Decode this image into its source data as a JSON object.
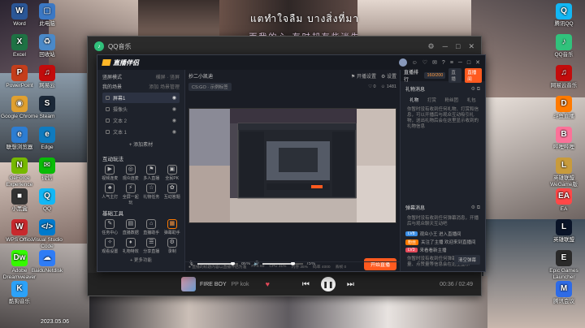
{
  "desktop": {
    "lyrics": {
      "line1": "แตทำใจลืม บางสิ่งที่มา",
      "line2": "而我的心 有时却有些迷失"
    },
    "date_text": "2023.05.06",
    "icons_left": [
      {
        "label": "Word",
        "color": "#2b5797",
        "glyph": "W"
      },
      {
        "label": "此电脑",
        "color": "#3b78c4",
        "glyph": "▢"
      },
      {
        "label": "Excel",
        "color": "#1f7244",
        "glyph": "X"
      },
      {
        "label": "回收站",
        "color": "#4a89c8",
        "glyph": "♻"
      },
      {
        "label": "PowerPoint",
        "color": "#c43e1c",
        "glyph": "P"
      },
      {
        "label": "网易云",
        "color": "#c20c0c",
        "glyph": "♫"
      },
      {
        "label": "Google Chrome",
        "color": "#e0a030",
        "glyph": "◉"
      },
      {
        "label": "Steam",
        "color": "#1b2838",
        "glyph": "S"
      },
      {
        "label": "联想浏览器",
        "color": "#2d7dd2",
        "glyph": "e"
      },
      {
        "label": "Edge",
        "color": "#0f7bbf",
        "glyph": "e"
      },
      {
        "label": "GeForce Experience",
        "color": "#76b900",
        "glyph": "N"
      },
      {
        "label": "微信",
        "color": "#09bb07",
        "glyph": "✉"
      },
      {
        "label": "小黑盒",
        "color": "#333333",
        "glyph": "■"
      },
      {
        "label": "QQ",
        "color": "#12b7f5",
        "glyph": "Q"
      },
      {
        "label": "WPS Office",
        "color": "#c8292d",
        "glyph": "W"
      },
      {
        "label": "Visual Studio Code",
        "color": "#007acc",
        "glyph": "</>"
      },
      {
        "label": "Adobe Dreamweaver",
        "color": "#35fa00",
        "glyph": "Dw"
      },
      {
        "label": "BaiduNetdisk",
        "color": "#2e7cf6",
        "glyph": "☁"
      },
      {
        "label": "酷狗音乐",
        "color": "#2ca2f9",
        "glyph": "K"
      }
    ],
    "icons_right": [
      {
        "label": "腾讯QQ",
        "color": "#12b7f5",
        "glyph": "Q"
      },
      {
        "label": "QQ音乐",
        "color": "#31c27c",
        "glyph": "♪"
      },
      {
        "label": "网易云音乐",
        "color": "#c20c0c",
        "glyph": "♫"
      },
      {
        "label": "斗鱼直播",
        "color": "#ff7a00",
        "glyph": "D"
      },
      {
        "label": "哔哩哔哩",
        "color": "#fb7299",
        "glyph": "B"
      },
      {
        "label": "英雄联盟 WeGame版",
        "color": "#c89b3c",
        "glyph": "L"
      },
      {
        "label": "EA",
        "color": "#ff4747",
        "glyph": "EA"
      },
      {
        "label": "英雄联盟",
        "color": "#0a1428",
        "glyph": "L"
      },
      {
        "label": "Epic Games Launcher",
        "color": "#2a2a2a",
        "glyph": "E"
      },
      {
        "label": "腾讯会议",
        "color": "#2e6be6",
        "glyph": "M"
      }
    ]
  },
  "qq_music": {
    "title": "QQ音乐",
    "track_title": "FIRE BOY",
    "track_artist": "PP kok",
    "time": "00:36 / 02:49",
    "win_controls": [
      "⚙",
      "─",
      "□",
      "✕"
    ]
  },
  "live_app": {
    "brand": "直播伴侣",
    "head_icons": [
      "☺",
      "♡",
      "✉",
      "?",
      "≡",
      "─",
      "□",
      "✕"
    ],
    "left": {
      "mode_label": "竖屏模式",
      "mode_options": [
        "横屏",
        "竖屏"
      ],
      "scene_label": "我的场景",
      "scene_actions": [
        "添加",
        "场景管理"
      ],
      "scenes": [
        {
          "name": "屏幕1",
          "active": true
        },
        {
          "name": "摄像头",
          "active": false
        },
        {
          "name": "文本 2",
          "active": false
        },
        {
          "name": "文本 1",
          "active": false
        }
      ],
      "add_source": "+ 添加素材",
      "interact_title": "互动玩法",
      "interact_tools": [
        {
          "icon": "▶",
          "label": "视频连麦"
        },
        {
          "icon": "◎",
          "label": "观众连麦"
        },
        {
          "icon": "⚑",
          "label": "多人直播"
        },
        {
          "icon": "▣",
          "label": "全民PK"
        },
        {
          "icon": "♣",
          "label": "人气主打"
        },
        {
          "icon": "⚡",
          "label": "全屏一起玩"
        },
        {
          "icon": "☆",
          "label": "礼物任务"
        },
        {
          "icon": "✿",
          "label": "互动答题"
        }
      ],
      "tools_title": "基础工具",
      "basic_tools": [
        {
          "icon": "✎",
          "label": "任务中心",
          "active": false
        },
        {
          "icon": "▤",
          "label": "直播数据",
          "active": false
        },
        {
          "icon": "⌂",
          "label": "直播助手",
          "active": false
        },
        {
          "icon": "▦",
          "label": "弹幕助手",
          "active": true
        },
        {
          "icon": "✧",
          "label": "观看设置",
          "active": false
        },
        {
          "icon": "♦",
          "label": "礼物特效",
          "active": false
        },
        {
          "icon": "☰",
          "label": "分享直播",
          "active": false
        },
        {
          "icon": "⚙",
          "label": "录制",
          "active": false
        }
      ],
      "more_tools": "+ 更多功能"
    },
    "center": {
      "room_name": "抄二小凯迪",
      "head_right": [
        "⚑ 开播设置",
        "⚙ 设置"
      ],
      "category": "CS:GO · 示例标签",
      "stats": [
        "♡ 0",
        "☺ 1481"
      ],
      "mic_volume": "86%",
      "desktop_volume": "75%",
      "mic_fill": 0.86,
      "desktop_fill": 0.75,
      "start_button": "开始直播",
      "status": [
        "● 直播的标题内容以直播伴侣为准",
        "FPS 60",
        "CPU 31%",
        "内存 35%",
        "码率 4000",
        "丢帧 0"
      ]
    },
    "right": {
      "tab_label": "直播排行",
      "count": "160/200",
      "buttons": [
        "直播",
        "直播间"
      ],
      "gift_panel_title": "礼物消息",
      "gift_tabs": [
        "礼物",
        "打赏",
        "粉丝团",
        "礼包"
      ],
      "gift_note": "你暂时没有收到任何礼物、打赏和信息，可以开播后与观众互动吸引礼物，送出礼物后会在这里显示收到的礼物信息",
      "comment_panel_title": "弹幕消息",
      "comment_note": "你暂时没有收到任何弹幕消息，开播后与观众聊天互动吧",
      "comments": [
        {
          "tag": "LV8",
          "tag_color": "#3a8ee6",
          "text": "观众小王 进入直播间"
        },
        {
          "tag": "粉丝",
          "tag_color": "#ff7a00",
          "text": "关注了主播 欢迎来到直播间"
        },
        {
          "tag": "LV3",
          "tag_color": "#e64a5a",
          "text": "来看看新主播"
        }
      ],
      "comment_note2": "你暂时没有收到任何弹幕信息，观看量、点赞量等信息会在这里显示",
      "clear_button": "清空弹幕"
    }
  }
}
